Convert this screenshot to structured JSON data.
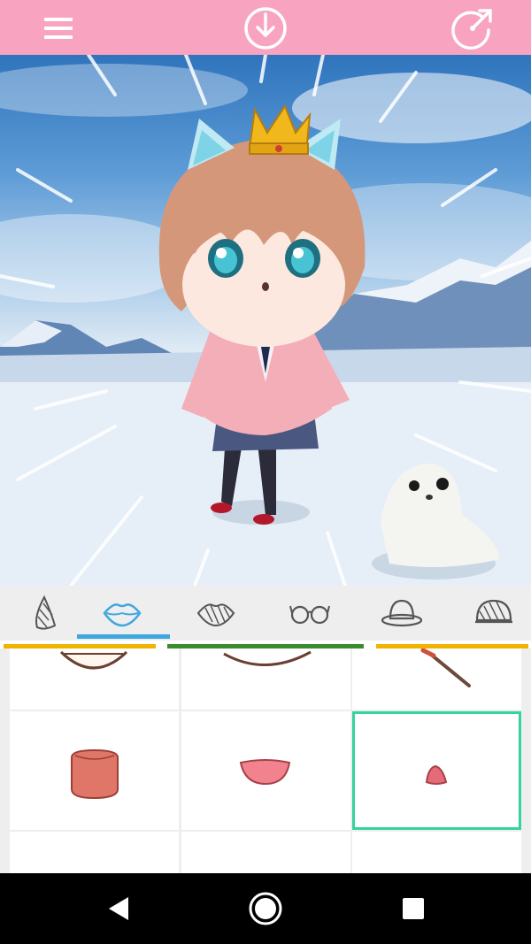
{
  "topbar": {
    "color": "#f8a4c0",
    "buttons": [
      {
        "name": "menu",
        "icon": "hamburger-menu-icon"
      },
      {
        "name": "save",
        "icon": "download-icon"
      },
      {
        "name": "share",
        "icon": "share-icon"
      }
    ]
  },
  "canvas": {
    "background": "snowy-mountains-sky",
    "character": "chibi-girl-with-cat-ears-crown-pink-cardigan",
    "pet": "baby-seal"
  },
  "tabs": {
    "accent": "#3ea7e0",
    "selected_index": 1,
    "items": [
      {
        "name": "nose",
        "icon": "nose-icon"
      },
      {
        "name": "mouth",
        "icon": "lips-icon"
      },
      {
        "name": "mouth-pattern",
        "icon": "patterned-lips-icon"
      },
      {
        "name": "glasses",
        "icon": "glasses-icon"
      },
      {
        "name": "hat",
        "icon": "bowler-hat-icon"
      },
      {
        "name": "hat-pattern",
        "icon": "patterned-hat-icon"
      }
    ]
  },
  "color_strips": [
    "#f0b400",
    "#3a8a2e",
    "#f0b400"
  ],
  "grid": {
    "selected_cell": 5,
    "items": [
      {
        "name": "mouth-wide-smile-outline"
      },
      {
        "name": "mouth-smile-line"
      },
      {
        "name": "mouth-with-lollipop"
      },
      {
        "name": "mouth-open-round"
      },
      {
        "name": "mouth-open-tongue"
      },
      {
        "name": "mouth-small-pout"
      },
      {
        "name": "mouth-empty-a"
      },
      {
        "name": "mouth-empty-b"
      },
      {
        "name": "mouth-empty-c"
      }
    ]
  },
  "navbar": {
    "buttons": [
      {
        "name": "back",
        "icon": "back-triangle-icon"
      },
      {
        "name": "home",
        "icon": "home-circle-icon"
      },
      {
        "name": "recents",
        "icon": "recents-square-icon"
      }
    ]
  }
}
